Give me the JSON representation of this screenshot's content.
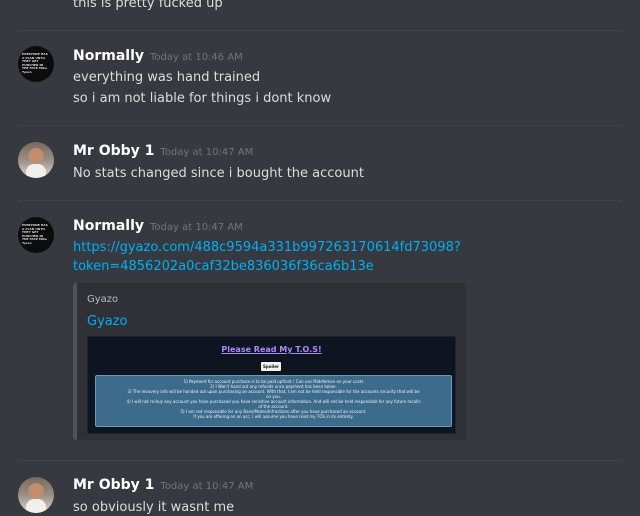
{
  "messages": [
    {
      "username": "",
      "timestamp": "",
      "lines": [
        "this is pretty fucked up"
      ]
    },
    {
      "username": "Normally",
      "timestamp": "Today at 10:46 AM",
      "avatar_text": "EVERYONE HAS A PLAN UNTIL THEY GET PUNCHED IN THE FACE Mike Tyson",
      "lines": [
        "everything was hand trained",
        "so i am not liable for things i dont know"
      ]
    },
    {
      "username": "Mr Obby 1",
      "timestamp": "Today at 10:47 AM",
      "lines": [
        "No stats changed since i bought the account"
      ]
    },
    {
      "username": "Normally",
      "timestamp": "Today at 10:47 AM",
      "avatar_text": "EVERYONE HAS A PLAN UNTIL THEY GET PUNCHED IN THE FACE Mike Tyson",
      "link_lines": [
        "https://gyazo.com/488c9594a331b997263170614fd73098?",
        "token=4856202a0caf32be836036f36ca6b13e"
      ],
      "embed": {
        "provider": "Gyazo",
        "title": "Gyazo",
        "image": {
          "heading": "Please Read My T.O.S!",
          "spoiler_label": "Spoiler",
          "tos_lines": [
            "1) Payment for account purchase is to be paid upfront / Can use Middleman on your costs",
            "2) I Won't hand out any refunds once payment has been taken.",
            "3) The recovery info will be handed out upon purchasing an account. With that, I am not be held responsible for the accounts security that will be",
            "on you.",
            "4) I will not re-buy any account you have purchased you have sensitive account information. And will not be held responsible for any future recalls",
            "of the account.",
            "5) I am not responsible for any Bans/Mutes/Infractions after you have purchased an account.",
            "If you are offering on an acc, I will assume you have read my TOS in its entirety."
          ]
        }
      }
    },
    {
      "username": "Mr Obby 1",
      "timestamp": "Today at 10:47 AM",
      "lines": [
        "so obviously it wasnt me"
      ]
    }
  ],
  "colors": {
    "background": "#36393f",
    "username": "#ffffff",
    "timestamp": "#72767d",
    "text": "#dcddde",
    "link": "#00b0f4",
    "embed_bg": "#2f3136",
    "tos_title": "#a78bfa"
  }
}
